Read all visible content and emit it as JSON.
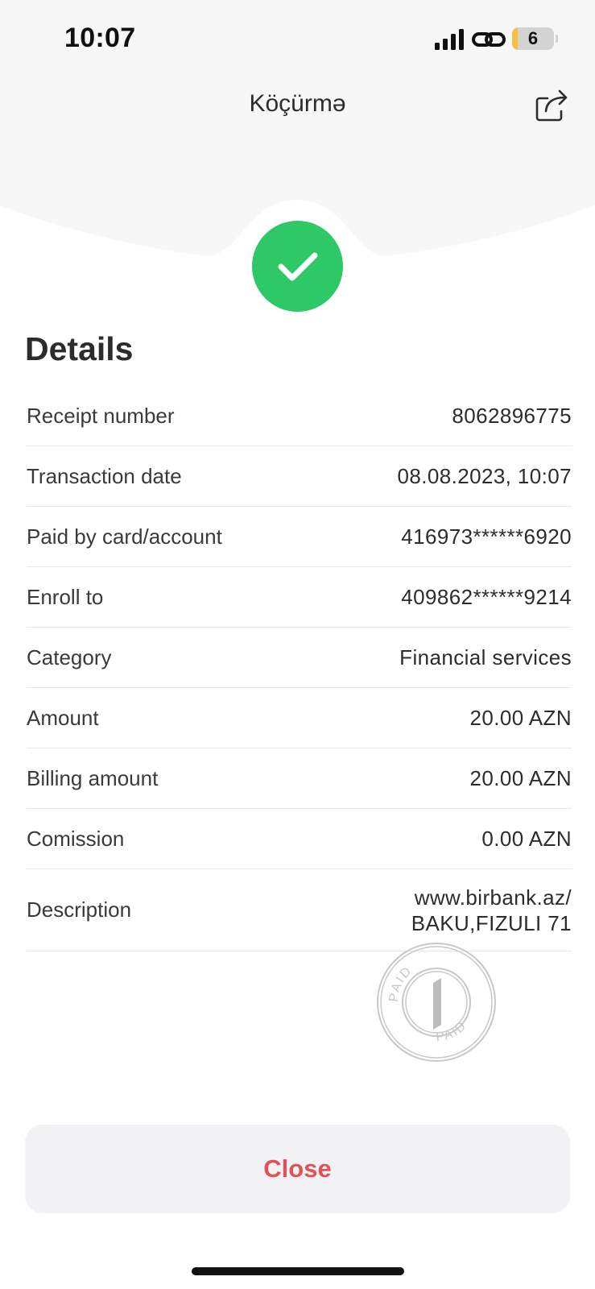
{
  "status_bar": {
    "time": "10:07",
    "battery_level": "6"
  },
  "header": {
    "title": "Köçürmə"
  },
  "details": {
    "title": "Details",
    "rows": [
      {
        "label": "Receipt number",
        "value": "8062896775"
      },
      {
        "label": "Transaction date",
        "value": "08.08.2023, 10:07"
      },
      {
        "label": "Paid by card/account",
        "value": "416973******6920"
      },
      {
        "label": "Enroll to",
        "value": "409862******9214"
      },
      {
        "label": "Category",
        "value": "Financial services"
      },
      {
        "label": "Amount",
        "value": "20.00 AZN"
      },
      {
        "label": "Billing amount",
        "value": "20.00 AZN"
      },
      {
        "label": "Comission",
        "value": "0.00 AZN"
      },
      {
        "label": "Description",
        "value_line1": "www.birbank.az/",
        "value_line2": "BAKU,FIZULI 71"
      }
    ]
  },
  "stamp": {
    "text": "PAID"
  },
  "footer": {
    "close_label": "Close"
  },
  "icons": {
    "success": "checkmark-icon",
    "share": "share-icon",
    "signal": "cellular-signal-icon",
    "link": "personal-hotspot-icon"
  },
  "colors": {
    "success_green": "#2ec866",
    "close_red": "#e05257",
    "header_background": "#f7f7f7"
  }
}
